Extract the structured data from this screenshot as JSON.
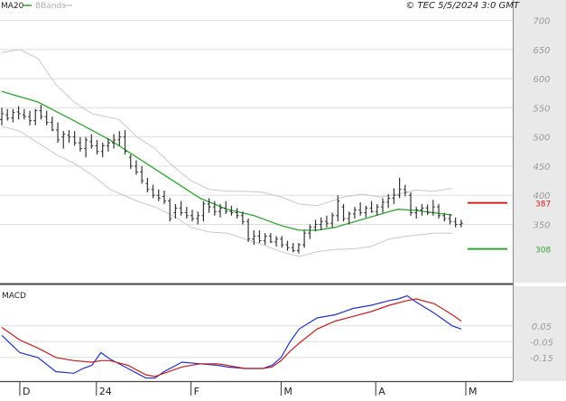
{
  "header": {
    "legend": [
      {
        "label": "MA20",
        "color": "#2fa52f"
      },
      {
        "label": "BBands",
        "color": "#c8c8c8"
      }
    ],
    "source": "© TEC 5/5/2024 3:0 GMT"
  },
  "colors": {
    "price_bars": "#333333",
    "ma20": "#2fa52f",
    "bbands": "#c8c8c8",
    "resistance": "#d42020",
    "support": "#2fa52f",
    "macd_line": "#2433c8",
    "signal_line": "#c81e1e",
    "grid": "#dddddd",
    "axis_band": "#e9e9e9"
  },
  "chart_data": [
    {
      "type": "line",
      "ylim": [
        250,
        735
      ],
      "y_ticks": [
        350,
        400,
        450,
        500,
        550,
        600,
        650,
        700
      ],
      "y_tick_labels": [
        "350",
        "400",
        "450",
        "500",
        "550",
        "600",
        "650",
        "700"
      ],
      "x_labels": [
        {
          "label": "D",
          "x": 4
        },
        {
          "label": "24",
          "x": 21
        },
        {
          "label": "F",
          "x": 42
        },
        {
          "label": "M",
          "x": 62
        },
        {
          "label": "A",
          "x": 83
        },
        {
          "label": "M",
          "x": 103
        }
      ],
      "levels": [
        {
          "name": "resistance",
          "value": 387,
          "label": "387"
        },
        {
          "name": "support",
          "value": 308,
          "label": "308"
        }
      ],
      "series": [
        {
          "name": "MA20",
          "points": [
            [
              0,
              578
            ],
            [
              8,
              560
            ],
            [
              16,
              528
            ],
            [
              24,
              495
            ],
            [
              32,
              455
            ],
            [
              38,
              425
            ],
            [
              44,
              395
            ],
            [
              50,
              376
            ],
            [
              56,
              365
            ],
            [
              62,
              348
            ],
            [
              66,
              340
            ],
            [
              70,
              340
            ],
            [
              74,
              345
            ],
            [
              78,
              354
            ],
            [
              82,
              363
            ],
            [
              86,
              372
            ],
            [
              88,
              376
            ],
            [
              92,
              374
            ],
            [
              96,
              370
            ],
            [
              100,
              366
            ]
          ]
        },
        {
          "name": "BBands-upper",
          "points": [
            [
              0,
              645
            ],
            [
              4,
              650
            ],
            [
              8,
              635
            ],
            [
              12,
              590
            ],
            [
              16,
              560
            ],
            [
              20,
              540
            ],
            [
              26,
              530
            ],
            [
              30,
              500
            ],
            [
              34,
              480
            ],
            [
              38,
              450
            ],
            [
              42,
              425
            ],
            [
              46,
              410
            ],
            [
              50,
              407
            ],
            [
              54,
              407
            ],
            [
              58,
              405
            ],
            [
              62,
              397
            ],
            [
              66,
              385
            ],
            [
              70,
              382
            ],
            [
              76,
              397
            ],
            [
              80,
              402
            ],
            [
              84,
              397
            ],
            [
              88,
              402
            ],
            [
              92,
              409
            ],
            [
              96,
              407
            ],
            [
              100,
              412
            ]
          ]
        },
        {
          "name": "BBands-lower",
          "points": [
            [
              0,
              518
            ],
            [
              4,
              510
            ],
            [
              8,
              490
            ],
            [
              12,
              470
            ],
            [
              16,
              455
            ],
            [
              20,
              435
            ],
            [
              24,
              410
            ],
            [
              30,
              390
            ],
            [
              34,
              380
            ],
            [
              38,
              365
            ],
            [
              42,
              345
            ],
            [
              46,
              337
            ],
            [
              50,
              335
            ],
            [
              54,
              325
            ],
            [
              58,
              315
            ],
            [
              62,
              303
            ],
            [
              66,
              295
            ],
            [
              70,
              303
            ],
            [
              74,
              307
            ],
            [
              78,
              308
            ],
            [
              82,
              312
            ],
            [
              86,
              325
            ],
            [
              90,
              330
            ],
            [
              96,
              335
            ],
            [
              100,
              335
            ]
          ]
        }
      ],
      "ohlc": [
        [
          0,
          530,
          550,
          520,
          540
        ],
        [
          1,
          538,
          548,
          528,
          532
        ],
        [
          2,
          533,
          548,
          525,
          542
        ],
        [
          3,
          543,
          553,
          530,
          540
        ],
        [
          4,
          538,
          548,
          530,
          535
        ],
        [
          5,
          535,
          545,
          520,
          528
        ],
        [
          6,
          528,
          548,
          520,
          545
        ],
        [
          7,
          545,
          555,
          530,
          535
        ],
        [
          8,
          535,
          545,
          520,
          525
        ],
        [
          9,
          525,
          535,
          510,
          512
        ],
        [
          10,
          512,
          525,
          490,
          495
        ],
        [
          11,
          500,
          510,
          480,
          505
        ],
        [
          12,
          503,
          512,
          490,
          500
        ],
        [
          13,
          500,
          510,
          485,
          490
        ],
        [
          14,
          490,
          500,
          475,
          480
        ],
        [
          15,
          480,
          500,
          465,
          495
        ],
        [
          16,
          492,
          505,
          480,
          485
        ],
        [
          17,
          485,
          495,
          470,
          475
        ],
        [
          18,
          475,
          490,
          465,
          485
        ],
        [
          19,
          485,
          498,
          475,
          490
        ],
        [
          20,
          490,
          505,
          480,
          495
        ],
        [
          21,
          495,
          510,
          485,
          500
        ],
        [
          22,
          500,
          512,
          470,
          475
        ],
        [
          23,
          465,
          470,
          445,
          450
        ],
        [
          24,
          450,
          460,
          435,
          440
        ],
        [
          25,
          440,
          450,
          420,
          425
        ],
        [
          26,
          420,
          430,
          405,
          410
        ],
        [
          27,
          410,
          418,
          395,
          400
        ],
        [
          28,
          400,
          410,
          390,
          395
        ],
        [
          29,
          398,
          408,
          385,
          390
        ],
        [
          30,
          390,
          395,
          355,
          360
        ],
        [
          31,
          370,
          385,
          360,
          378
        ],
        [
          32,
          378,
          390,
          365,
          370
        ],
        [
          33,
          370,
          380,
          360,
          365
        ],
        [
          34,
          365,
          375,
          355,
          360
        ],
        [
          35,
          360,
          372,
          350,
          365
        ],
        [
          36,
          365,
          390,
          355,
          385
        ],
        [
          37,
          385,
          395,
          370,
          380
        ],
        [
          38,
          380,
          390,
          365,
          372
        ],
        [
          39,
          372,
          385,
          362,
          378
        ],
        [
          40,
          378,
          390,
          368,
          372
        ],
        [
          41,
          372,
          382,
          365,
          370
        ],
        [
          42,
          370,
          378,
          360,
          365
        ],
        [
          43,
          365,
          372,
          350,
          355
        ],
        [
          44,
          355,
          360,
          320,
          325
        ],
        [
          45,
          325,
          340,
          315,
          330
        ],
        [
          46,
          330,
          340,
          318,
          322
        ],
        [
          47,
          322,
          335,
          315,
          330
        ],
        [
          48,
          330,
          335,
          318,
          320
        ],
        [
          49,
          320,
          330,
          312,
          325
        ],
        [
          50,
          325,
          330,
          310,
          315
        ],
        [
          51,
          315,
          322,
          305,
          310
        ],
        [
          52,
          310,
          318,
          302,
          305
        ],
        [
          53,
          305,
          318,
          300,
          315
        ],
        [
          54,
          315,
          340,
          310,
          335
        ],
        [
          55,
          335,
          350,
          325,
          345
        ],
        [
          56,
          345,
          358,
          338,
          350
        ],
        [
          57,
          350,
          362,
          340,
          355
        ],
        [
          58,
          355,
          365,
          345,
          352
        ],
        [
          59,
          352,
          370,
          345,
          365
        ],
        [
          60,
          365,
          400,
          355,
          390
        ],
        [
          61,
          380,
          385,
          355,
          360
        ],
        [
          62,
          360,
          372,
          350,
          368
        ],
        [
          63,
          368,
          380,
          360,
          375
        ],
        [
          64,
          375,
          388,
          365,
          370
        ],
        [
          65,
          370,
          382,
          362,
          378
        ],
        [
          66,
          378,
          390,
          370,
          372
        ],
        [
          67,
          372,
          385,
          365,
          380
        ],
        [
          68,
          380,
          395,
          370,
          388
        ],
        [
          69,
          388,
          402,
          378,
          395
        ],
        [
          70,
          395,
          412,
          385,
          400
        ],
        [
          71,
          400,
          430,
          395,
          410
        ],
        [
          72,
          410,
          418,
          398,
          405
        ],
        [
          73,
          400,
          405,
          365,
          370
        ],
        [
          74,
          370,
          380,
          360,
          375
        ],
        [
          75,
          375,
          385,
          365,
          378
        ],
        [
          76,
          378,
          384,
          366,
          370
        ],
        [
          77,
          370,
          392,
          365,
          380
        ],
        [
          78,
          380,
          385,
          360,
          365
        ],
        [
          79,
          365,
          370,
          355,
          360
        ],
        [
          80,
          360,
          368,
          350,
          355
        ],
        [
          81,
          355,
          362,
          345,
          350
        ],
        [
          82,
          350,
          358,
          345,
          352
        ]
      ]
    },
    {
      "type": "line",
      "title": "MACD",
      "ylim": [
        -30,
        30
      ],
      "y_ticks": [
        5,
        -5,
        -15
      ],
      "y_tick_labels": [
        "0.05",
        "-0.05",
        "-0.15"
      ],
      "series": [
        {
          "name": "MACD",
          "points": [
            [
              0,
              -1
            ],
            [
              4,
              -12
            ],
            [
              8,
              -15
            ],
            [
              12,
              -24
            ],
            [
              16,
              -25
            ],
            [
              18,
              -22
            ],
            [
              20,
              -20
            ],
            [
              22,
              -12
            ],
            [
              24,
              -16
            ],
            [
              28,
              -22
            ],
            [
              30,
              -25
            ],
            [
              32,
              -28
            ],
            [
              34,
              -28
            ],
            [
              36,
              -24
            ],
            [
              40,
              -18
            ],
            [
              44,
              -19
            ],
            [
              48,
              -20
            ],
            [
              50,
              -21
            ],
            [
              54,
              -22
            ],
            [
              58,
              -22
            ],
            [
              60,
              -20
            ],
            [
              62,
              -15
            ],
            [
              64,
              -5
            ],
            [
              66,
              3
            ],
            [
              70,
              10
            ],
            [
              74,
              12
            ],
            [
              78,
              16
            ],
            [
              82,
              18
            ],
            [
              86,
              21
            ],
            [
              88,
              22
            ],
            [
              90,
              24
            ],
            [
              92,
              20
            ],
            [
              96,
              13
            ],
            [
              100,
              5
            ],
            [
              102,
              3
            ]
          ]
        },
        {
          "name": "Signal",
          "points": [
            [
              0,
              4
            ],
            [
              4,
              -4
            ],
            [
              8,
              -9
            ],
            [
              12,
              -15
            ],
            [
              16,
              -17
            ],
            [
              20,
              -18
            ],
            [
              22,
              -17
            ],
            [
              24,
              -17
            ],
            [
              28,
              -20
            ],
            [
              32,
              -26
            ],
            [
              34,
              -27
            ],
            [
              36,
              -25
            ],
            [
              40,
              -21
            ],
            [
              44,
              -19
            ],
            [
              48,
              -19
            ],
            [
              50,
              -20
            ],
            [
              54,
              -22
            ],
            [
              58,
              -22
            ],
            [
              60,
              -21
            ],
            [
              62,
              -17
            ],
            [
              64,
              -11
            ],
            [
              66,
              -6
            ],
            [
              70,
              3
            ],
            [
              74,
              8
            ],
            [
              78,
              11
            ],
            [
              82,
              14
            ],
            [
              86,
              18
            ],
            [
              90,
              21
            ],
            [
              92,
              22
            ],
            [
              96,
              19
            ],
            [
              100,
              12
            ],
            [
              102,
              8
            ]
          ]
        }
      ]
    }
  ]
}
